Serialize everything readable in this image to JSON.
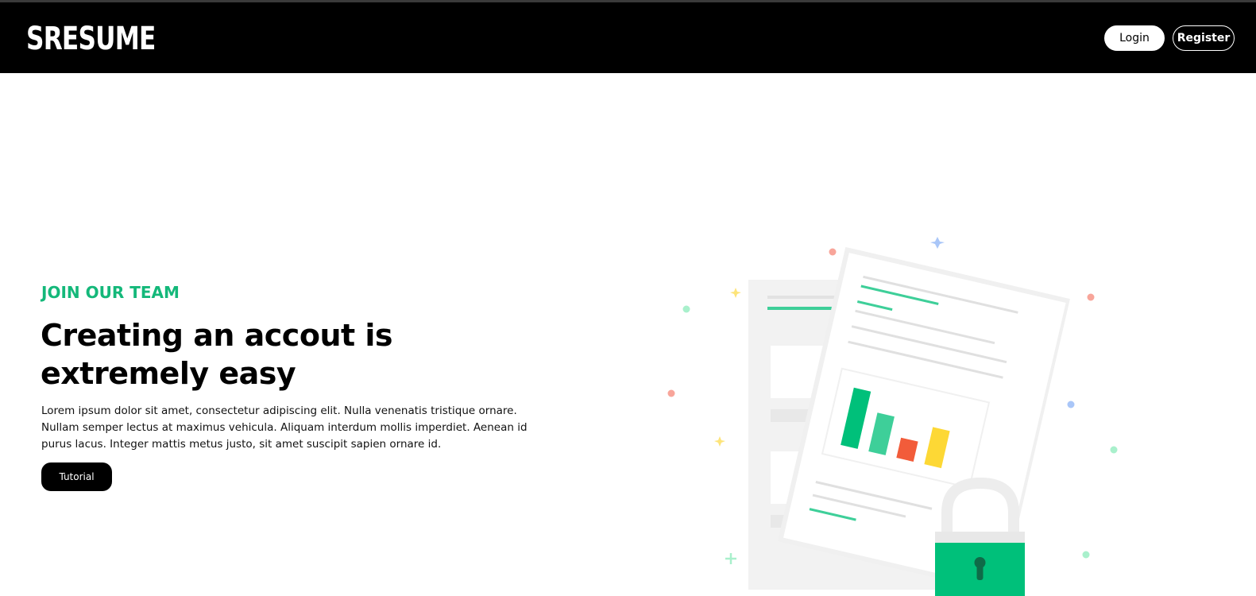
{
  "header": {
    "logo_text": "SRESUME",
    "login_label": "Login",
    "register_label": "Register"
  },
  "hero": {
    "eyebrow": "JOIN OUR TEAM",
    "headline": "Creating an accout is extremely easy",
    "body": "Lorem ipsum dolor sit amet, consectetur adipiscing elit. Nulla venenatis tristique ornare. Nullam semper lectus at maximus vehicula. Aliquam interdum mollis imperdiet. Aenean id purus lacus. Integer mattis metus justo, sit amet suscipit sapien ornare id.",
    "cta_label": "Tutorial"
  },
  "colors": {
    "accent": "#14b87a",
    "header_bg": "#000000",
    "chart_bar_1": "#00c07a",
    "chart_bar_2": "#3ecf99",
    "chart_bar_3": "#f25c3a",
    "chart_bar_4": "#fdd835"
  },
  "illustration": {
    "icons": [
      "document-icon",
      "bar-chart-icon",
      "padlock-icon",
      "sparkle-icon"
    ]
  }
}
